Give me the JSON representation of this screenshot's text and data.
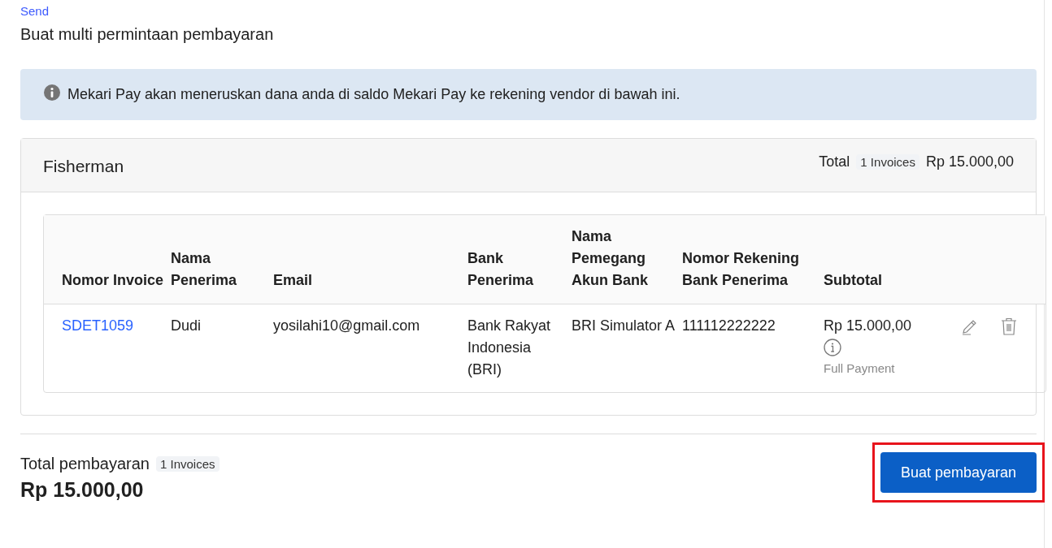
{
  "breadcrumb": "Send",
  "title": "Buat multi permintaan pembayaran",
  "info_banner": "Mekari Pay akan meneruskan dana anda di saldo Mekari Pay ke rekening vendor di bawah ini.",
  "vendor": {
    "name": "Fisherman",
    "total_label": "Total",
    "invoice_count": "1 Invoices",
    "total_amount": "Rp 15.000,00"
  },
  "table": {
    "columns": [
      "Nomor Invoice",
      "Nama Penerima",
      "Email",
      "Bank Penerima",
      "Nama Pemegang Akun Bank",
      "Nomor Rekening Bank Penerima",
      "Subtotal"
    ],
    "rows": [
      {
        "invoice": "SDET1059",
        "recipient": "Dudi",
        "email": "yosilahi10@gmail.com",
        "bank": "Bank Rakyat Indonesia (BRI)",
        "holder": "BRI Simulator A",
        "account": "111112222222",
        "subtotal": "Rp 15.000,00",
        "payment_type": "Full Payment"
      }
    ]
  },
  "footer": {
    "label": "Total pembayaran",
    "invoice_count": "1 Invoices",
    "amount": "Rp 15.000,00",
    "button": "Buat pembayaran",
    "button_highlighted": true
  }
}
